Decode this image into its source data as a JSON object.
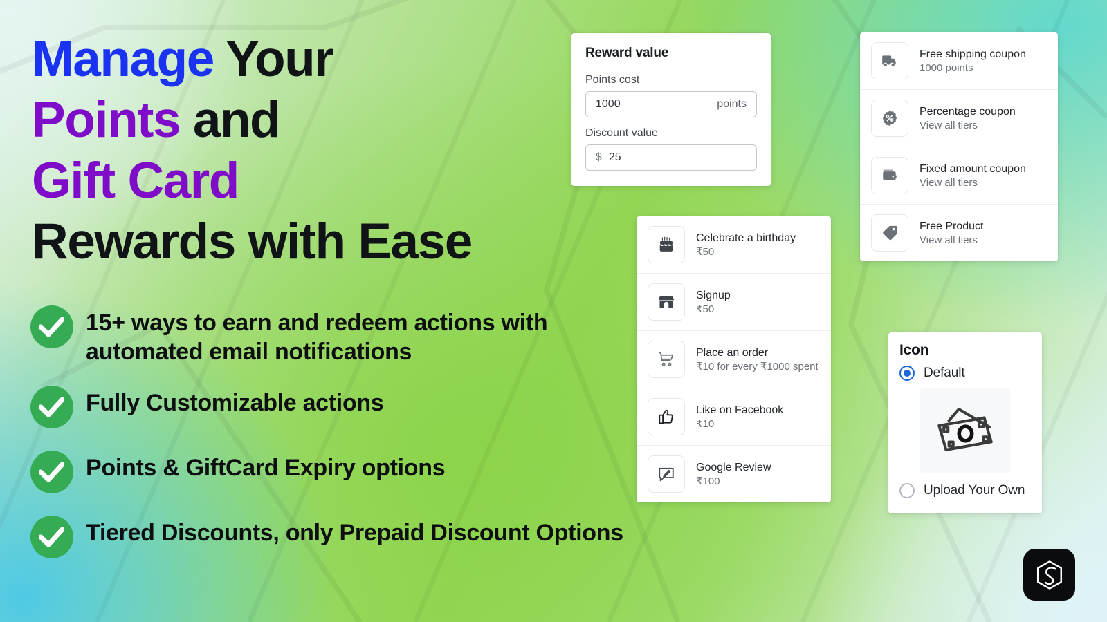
{
  "background": {
    "gradient_colors": [
      "#e5f5f1",
      "#5fd8d0",
      "#8cd44b",
      "#95d759",
      "#48c8e8",
      "#dff3f6"
    ]
  },
  "headline": {
    "line1_accent": "Manage",
    "line1_rest": " Your",
    "line2_accent": "Points",
    "line2_rest": " and",
    "line3_accent": "Gift Card",
    "line4": "Rewards with Ease",
    "accent_blue": "#1a33f2",
    "accent_purple": "#7f0cc9",
    "base_color": "#111416"
  },
  "features": {
    "check_color": "#35ab53",
    "items": [
      {
        "icon": "check-icon",
        "text": "15+ ways to earn and redeem actions with automated email notifications"
      },
      {
        "icon": "check-icon",
        "text": "Fully Customizable actions"
      },
      {
        "icon": "check-icon",
        "text": "Points & GiftCard Expiry options"
      },
      {
        "icon": "check-icon",
        "text": "Tiered Discounts, only Prepaid Discount Options"
      }
    ]
  },
  "reward_card": {
    "title": "Reward value",
    "points_cost": {
      "label": "Points cost",
      "value": "1000",
      "suffix": "points"
    },
    "discount_value": {
      "label": "Discount value",
      "prefix": "$",
      "value": "25"
    }
  },
  "coupon_card": {
    "rows": [
      {
        "icon": "truck-icon",
        "title": "Free shipping coupon",
        "sub": "1000 points"
      },
      {
        "icon": "percent-badge-icon",
        "title": "Percentage coupon",
        "sub": "View all tiers"
      },
      {
        "icon": "wallet-icon",
        "title": "Fixed amount coupon",
        "sub": "View all tiers"
      },
      {
        "icon": "tag-icon",
        "title": "Free Product",
        "sub": "View all tiers"
      }
    ]
  },
  "earn_card": {
    "rows": [
      {
        "icon": "birthday-cake-icon",
        "title": "Celebrate a birthday",
        "sub": "₹50"
      },
      {
        "icon": "storefront-icon",
        "title": "Signup",
        "sub": "₹50"
      },
      {
        "icon": "shopping-cart-icon",
        "title": "Place an order",
        "sub": "₹10 for every ₹1000 spent"
      },
      {
        "icon": "thumbs-up-icon",
        "title": "Like on Facebook",
        "sub": "₹10"
      },
      {
        "icon": "review-icon",
        "title": "Google Review",
        "sub": "₹100"
      }
    ]
  },
  "icon_card": {
    "title": "Icon",
    "option_default": "Default",
    "option_upload": "Upload Your Own",
    "preview_icon": "banknotes-icon",
    "selected": "Default",
    "radio_accent": "#1a68d6"
  },
  "logo": {
    "name": "hexagon-s-logo",
    "background": "#0b0c0e",
    "mark_color": "#ffffff"
  }
}
